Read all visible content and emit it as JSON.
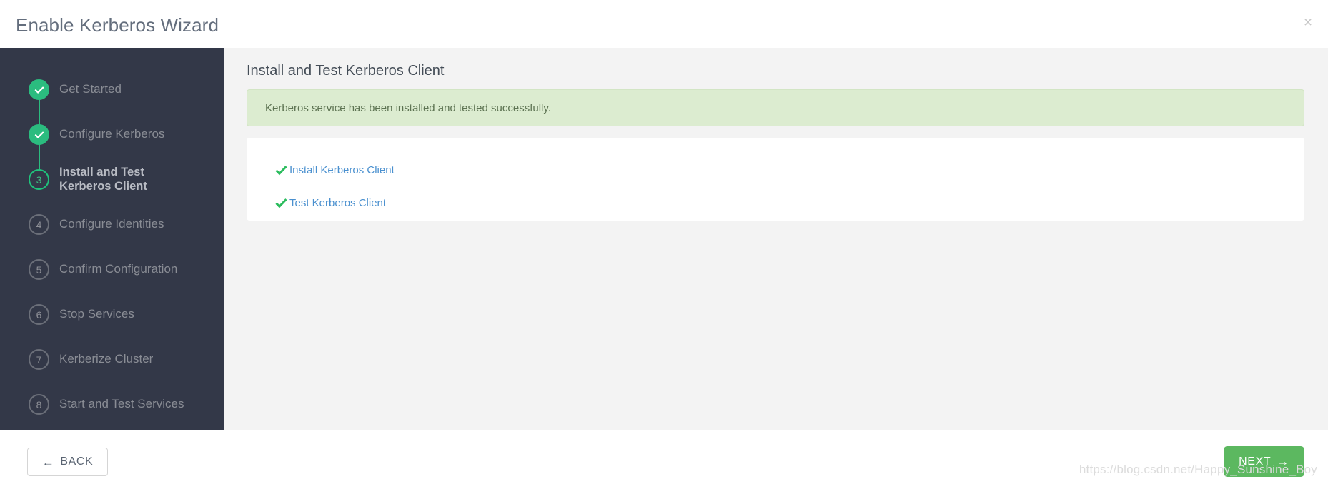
{
  "header": {
    "title": "Enable Kerberos Wizard",
    "close_label": "×"
  },
  "sidebar": {
    "steps": [
      {
        "number": "1",
        "label": "Get Started",
        "state": "done",
        "marker": "check-icon"
      },
      {
        "number": "2",
        "label": "Configure Kerberos",
        "state": "done",
        "marker": "check-icon"
      },
      {
        "number": "3",
        "label": "Install and Test\nKerberos Client",
        "state": "current",
        "marker": "3"
      },
      {
        "number": "4",
        "label": "Configure Identities",
        "state": "todo",
        "marker": "4"
      },
      {
        "number": "5",
        "label": "Confirm Configuration",
        "state": "todo",
        "marker": "5"
      },
      {
        "number": "6",
        "label": "Stop Services",
        "state": "todo",
        "marker": "6"
      },
      {
        "number": "7",
        "label": "Kerberize Cluster",
        "state": "todo",
        "marker": "7"
      },
      {
        "number": "8",
        "label": "Start and Test Services",
        "state": "todo",
        "marker": "8"
      }
    ]
  },
  "main": {
    "title": "Install and Test Kerberos Client",
    "alert": {
      "type": "success",
      "message": "Kerberos service has been installed and tested successfully."
    },
    "tasks": [
      {
        "label": "Install Kerberos Client",
        "status": "complete",
        "icon": "check-icon"
      },
      {
        "label": "Test Kerberos Client",
        "status": "complete",
        "icon": "check-icon"
      }
    ]
  },
  "footer": {
    "back_label": "BACK",
    "back_icon": "arrow-left-icon",
    "back_arrow": "←",
    "next_label": "NEXT",
    "next_icon": "arrow-right-icon",
    "next_arrow": "→"
  },
  "watermark": {
    "text": "https://blog.csdn.net/Happy_Sunshine_Boy"
  },
  "colors": {
    "sidebar_bg": "#333848",
    "accent_green": "#2bbc7f",
    "button_green": "#5cb860",
    "link_blue": "#4a90cf",
    "alert_bg": "#dcecd0",
    "content_bg": "#f3f3f3"
  }
}
